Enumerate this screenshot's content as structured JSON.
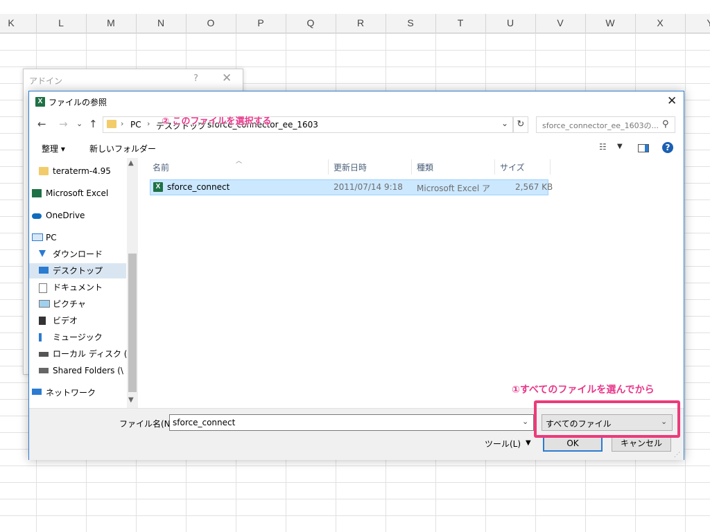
{
  "sheet": {
    "columns": [
      "K",
      "L",
      "M",
      "N",
      "O",
      "P",
      "Q",
      "R",
      "S",
      "T",
      "U",
      "V",
      "W",
      "X",
      "Y"
    ]
  },
  "addin_dialog": {
    "title": "アドイン",
    "help": "?",
    "close": "✕"
  },
  "dialog": {
    "title": "ファイルの参照",
    "close": "✕",
    "nav": {
      "back": "←",
      "forward": "→",
      "recent": "⌄",
      "up": "↑"
    },
    "breadcrumb": [
      "PC",
      "デスクトップ",
      "sforce_connector_ee_1603"
    ],
    "search_placeholder": "sforce_connector_ee_1603の...",
    "toolbar": {
      "organize": "整理 ▾",
      "new_folder": "新しいフォルダー"
    },
    "nav_items": [
      {
        "label": "teraterm-4.95",
        "icon": "folder-icon"
      },
      {
        "label": "Microsoft Excel",
        "icon": "excel-icon"
      },
      {
        "label": "OneDrive",
        "icon": "onedrive-icon"
      },
      {
        "label": "PC",
        "icon": "pc-icon"
      },
      {
        "label": "ダウンロード",
        "icon": "download-icon"
      },
      {
        "label": "デスクトップ",
        "icon": "desktop-icon",
        "selected": true
      },
      {
        "label": "ドキュメント",
        "icon": "documents-icon"
      },
      {
        "label": "ピクチャ",
        "icon": "pictures-icon"
      },
      {
        "label": "ビデオ",
        "icon": "videos-icon"
      },
      {
        "label": "ミュージック",
        "icon": "music-icon"
      },
      {
        "label": "ローカル ディスク (C",
        "icon": "disk-icon"
      },
      {
        "label": "Shared Folders (\\",
        "icon": "network-drive-icon"
      },
      {
        "label": "ネットワーク",
        "icon": "network-icon"
      }
    ],
    "columns": {
      "name": "名前",
      "modified": "更新日時",
      "type": "種類",
      "size": "サイズ"
    },
    "files": [
      {
        "name": "sforce_connect",
        "modified": "2011/07/14 9:18",
        "type": "Microsoft Excel ア...",
        "size": "2,567 KB"
      }
    ],
    "annotation_select": "② このファイルを選択する",
    "annotation_type": "①すべてのファイルを選んでから",
    "filename_label": "ファイル名(N):",
    "filename_value": "sforce_connect",
    "filetype_value": "すべてのファイル",
    "tools_label": "ツール(L)",
    "ok_label": "OK",
    "cancel_label": "キャンセル"
  },
  "colors": {
    "accent": "#2b7bd0",
    "annotation": "#e8388a",
    "highlight_border": "#ec3a7a",
    "selection": "#cce8ff"
  }
}
